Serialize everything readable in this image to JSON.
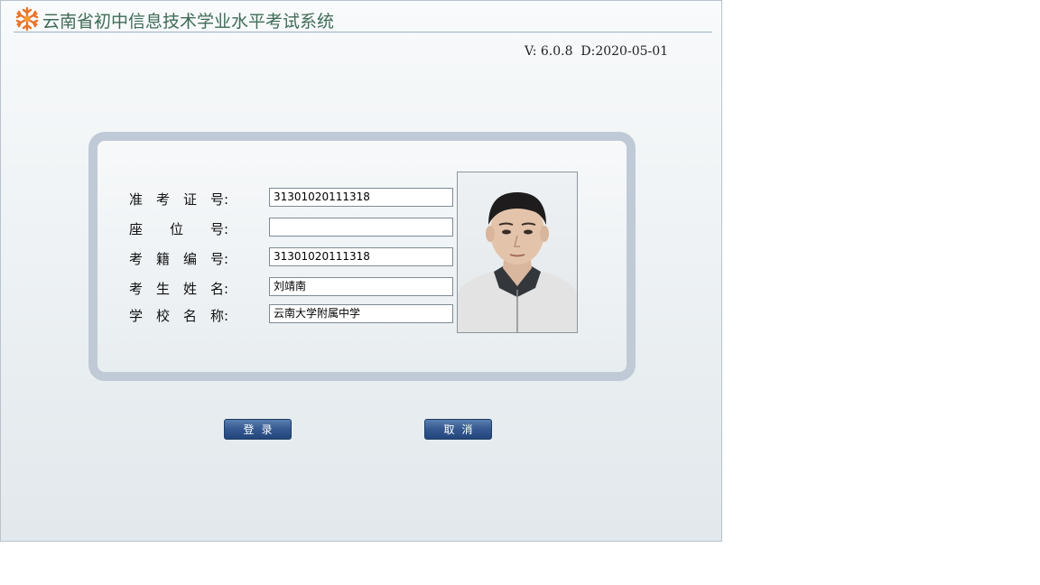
{
  "header": {
    "app_title": "云南省初中信息技术学业水平考试系统",
    "logo_icon": "snowflake-logo-icon"
  },
  "version_text": "V: 6.0.8  D:2020-05-01",
  "form": {
    "admission_no": {
      "label_chars": [
        "准",
        "考",
        "证",
        "号:"
      ],
      "value": "31301020111318"
    },
    "seat_no": {
      "label_chars": [
        "座",
        "位",
        "号:"
      ],
      "value": ""
    },
    "registry_no": {
      "label_chars": [
        "考",
        "籍",
        "编",
        "号:"
      ],
      "value": "31301020111318"
    },
    "student_name": {
      "label_chars": [
        "考",
        "生",
        "姓",
        "名:"
      ],
      "value": "刘靖南"
    },
    "school_name": {
      "label_chars": [
        "学",
        "校",
        "名",
        "称:"
      ],
      "value": "云南大学附属中学"
    }
  },
  "photo": {
    "icon": "student-photo"
  },
  "buttons": {
    "login": "登录",
    "cancel": "取消"
  },
  "colors": {
    "title": "#3f6b57",
    "button": "#34588f",
    "panel_border": "#c0cad6"
  }
}
